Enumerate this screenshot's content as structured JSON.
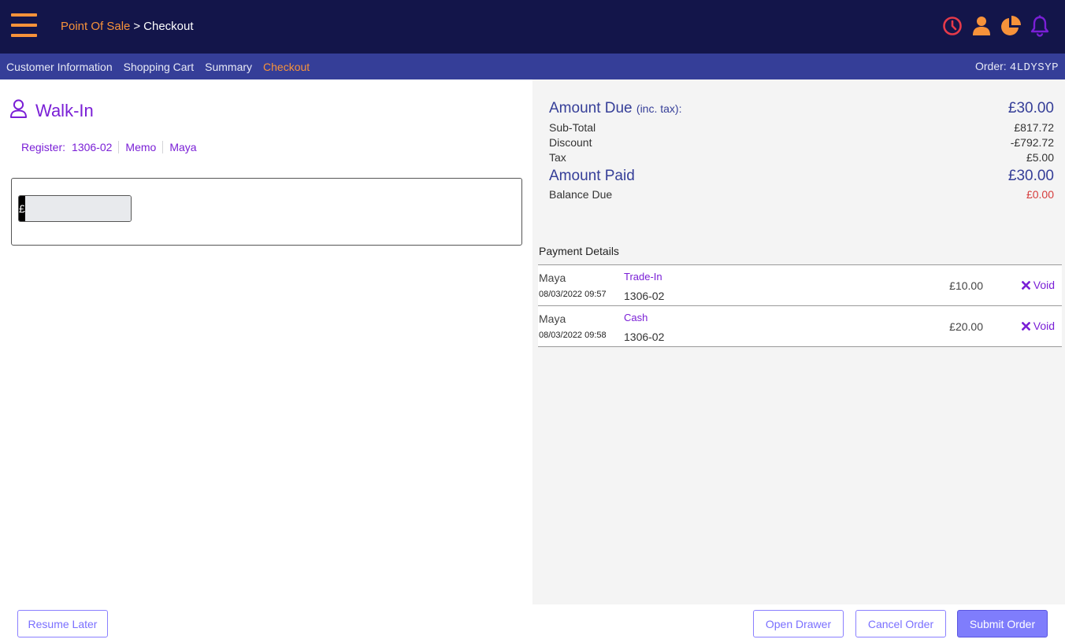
{
  "header": {
    "breadcrumb_root": "Point Of Sale",
    "breadcrumb_sep": ">",
    "breadcrumb_current": "Checkout",
    "icons": [
      "clock-icon",
      "user-icon",
      "pie-chart-icon",
      "bell-icon"
    ],
    "colors": {
      "bg": "#13154a",
      "accent": "#f7923a",
      "clock": "#e53a4a",
      "bell": "#7a1fd6"
    }
  },
  "nav": {
    "tabs": [
      {
        "label": "Customer Information",
        "active": false
      },
      {
        "label": "Shopping Cart",
        "active": false
      },
      {
        "label": "Summary",
        "active": false
      },
      {
        "label": "Checkout",
        "active": true
      }
    ],
    "order_label": "Order:",
    "order_code": "4LDYSYP"
  },
  "customer": {
    "name": "Walk-In",
    "register_label": "Register:",
    "register_value": "1306-02",
    "memo_label": "Memo",
    "clerk": "Maya"
  },
  "payment_input": {
    "currency_symbol": "£",
    "value": ""
  },
  "totals": {
    "amount_due_label": "Amount Due",
    "amount_due_note": "(inc. tax):",
    "amount_due_value": "£30.00",
    "subtotal_label": "Sub-Total",
    "subtotal_value": "£817.72",
    "discount_label": "Discount",
    "discount_value": "-£792.72",
    "tax_label": "Tax",
    "tax_value": "£5.00",
    "amount_paid_label": "Amount Paid",
    "amount_paid_value": "£30.00",
    "balance_due_label": "Balance Due",
    "balance_due_value": "£0.00"
  },
  "payment_details": {
    "title": "Payment Details",
    "rows": [
      {
        "user": "Maya",
        "date": "08/03/2022 09:57",
        "method": "Trade-In",
        "register": "1306-02",
        "amount": "£10.00",
        "void_label": "Void"
      },
      {
        "user": "Maya",
        "date": "08/03/2022 09:58",
        "method": "Cash",
        "register": "1306-02",
        "amount": "£20.00",
        "void_label": "Void"
      }
    ]
  },
  "footer": {
    "resume_later": "Resume Later",
    "open_drawer": "Open Drawer",
    "cancel_order": "Cancel Order",
    "submit_order": "Submit Order"
  }
}
